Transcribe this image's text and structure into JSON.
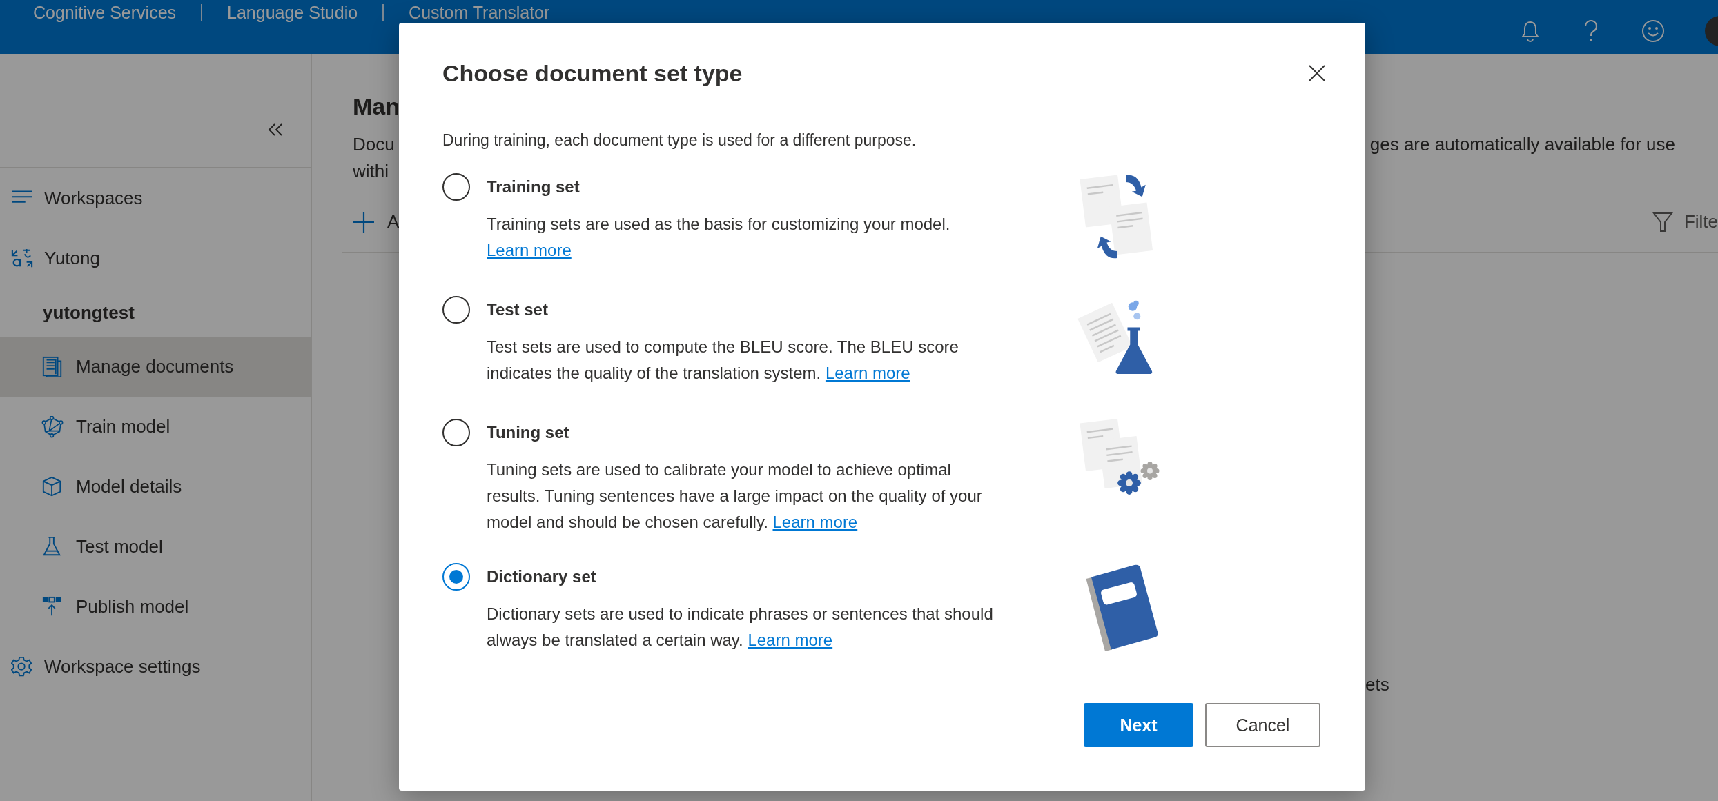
{
  "top_bar": {
    "breadcrumbs": [
      {
        "label": "Cognitive Services"
      },
      {
        "label": "Language Studio"
      },
      {
        "label": "Custom Translator"
      }
    ]
  },
  "sidebar": {
    "items": [
      {
        "kind": "nav",
        "label": "Workspaces",
        "selected": false
      },
      {
        "kind": "nav",
        "label": "Yutong",
        "selected": false
      },
      {
        "kind": "workspace_name",
        "label": "yutongtest"
      },
      {
        "kind": "page",
        "label": "Manage documents",
        "selected": true
      },
      {
        "kind": "page",
        "label": "Train model",
        "selected": false
      },
      {
        "kind": "page",
        "label": "Model details",
        "selected": false
      },
      {
        "kind": "page",
        "label": "Test model",
        "selected": false
      },
      {
        "kind": "page",
        "label": "Publish model",
        "selected": false
      },
      {
        "kind": "nav",
        "label": "Workspace settings",
        "selected": false
      }
    ]
  },
  "main": {
    "title": "Man",
    "description_left": [
      "Docu",
      "withi"
    ],
    "description_right": "ges are automatically available for use",
    "command": "A",
    "filter": "Filte",
    "fragment": "ets"
  },
  "dialog": {
    "title": "Choose document set type",
    "intro": "During training, each document type is used for a different purpose.",
    "options": [
      {
        "label": "Training set",
        "description": "Training sets are used as the basis for customizing your model.",
        "link": "Learn more",
        "selected": false
      },
      {
        "label": "Test set",
        "description": "Test sets are used to compute the BLEU score. The BLEU score indicates the quality of the translation system.",
        "link": "Learn more",
        "selected": false
      },
      {
        "label": "Tuning set",
        "description": "Tuning sets are used to calibrate your model to achieve optimal results. Tuning sentences have a large impact on the quality of your model and should be chosen carefully.",
        "link": "Learn more",
        "selected": false
      },
      {
        "label": "Dictionary set",
        "description": "Dictionary sets are used to indicate phrases or sentences that should always be translated a certain way.",
        "link": "Learn more",
        "selected": true
      }
    ],
    "buttons": [
      {
        "label": "Next",
        "kind": "primary"
      },
      {
        "label": "Cancel",
        "kind": "secondary"
      }
    ]
  }
}
